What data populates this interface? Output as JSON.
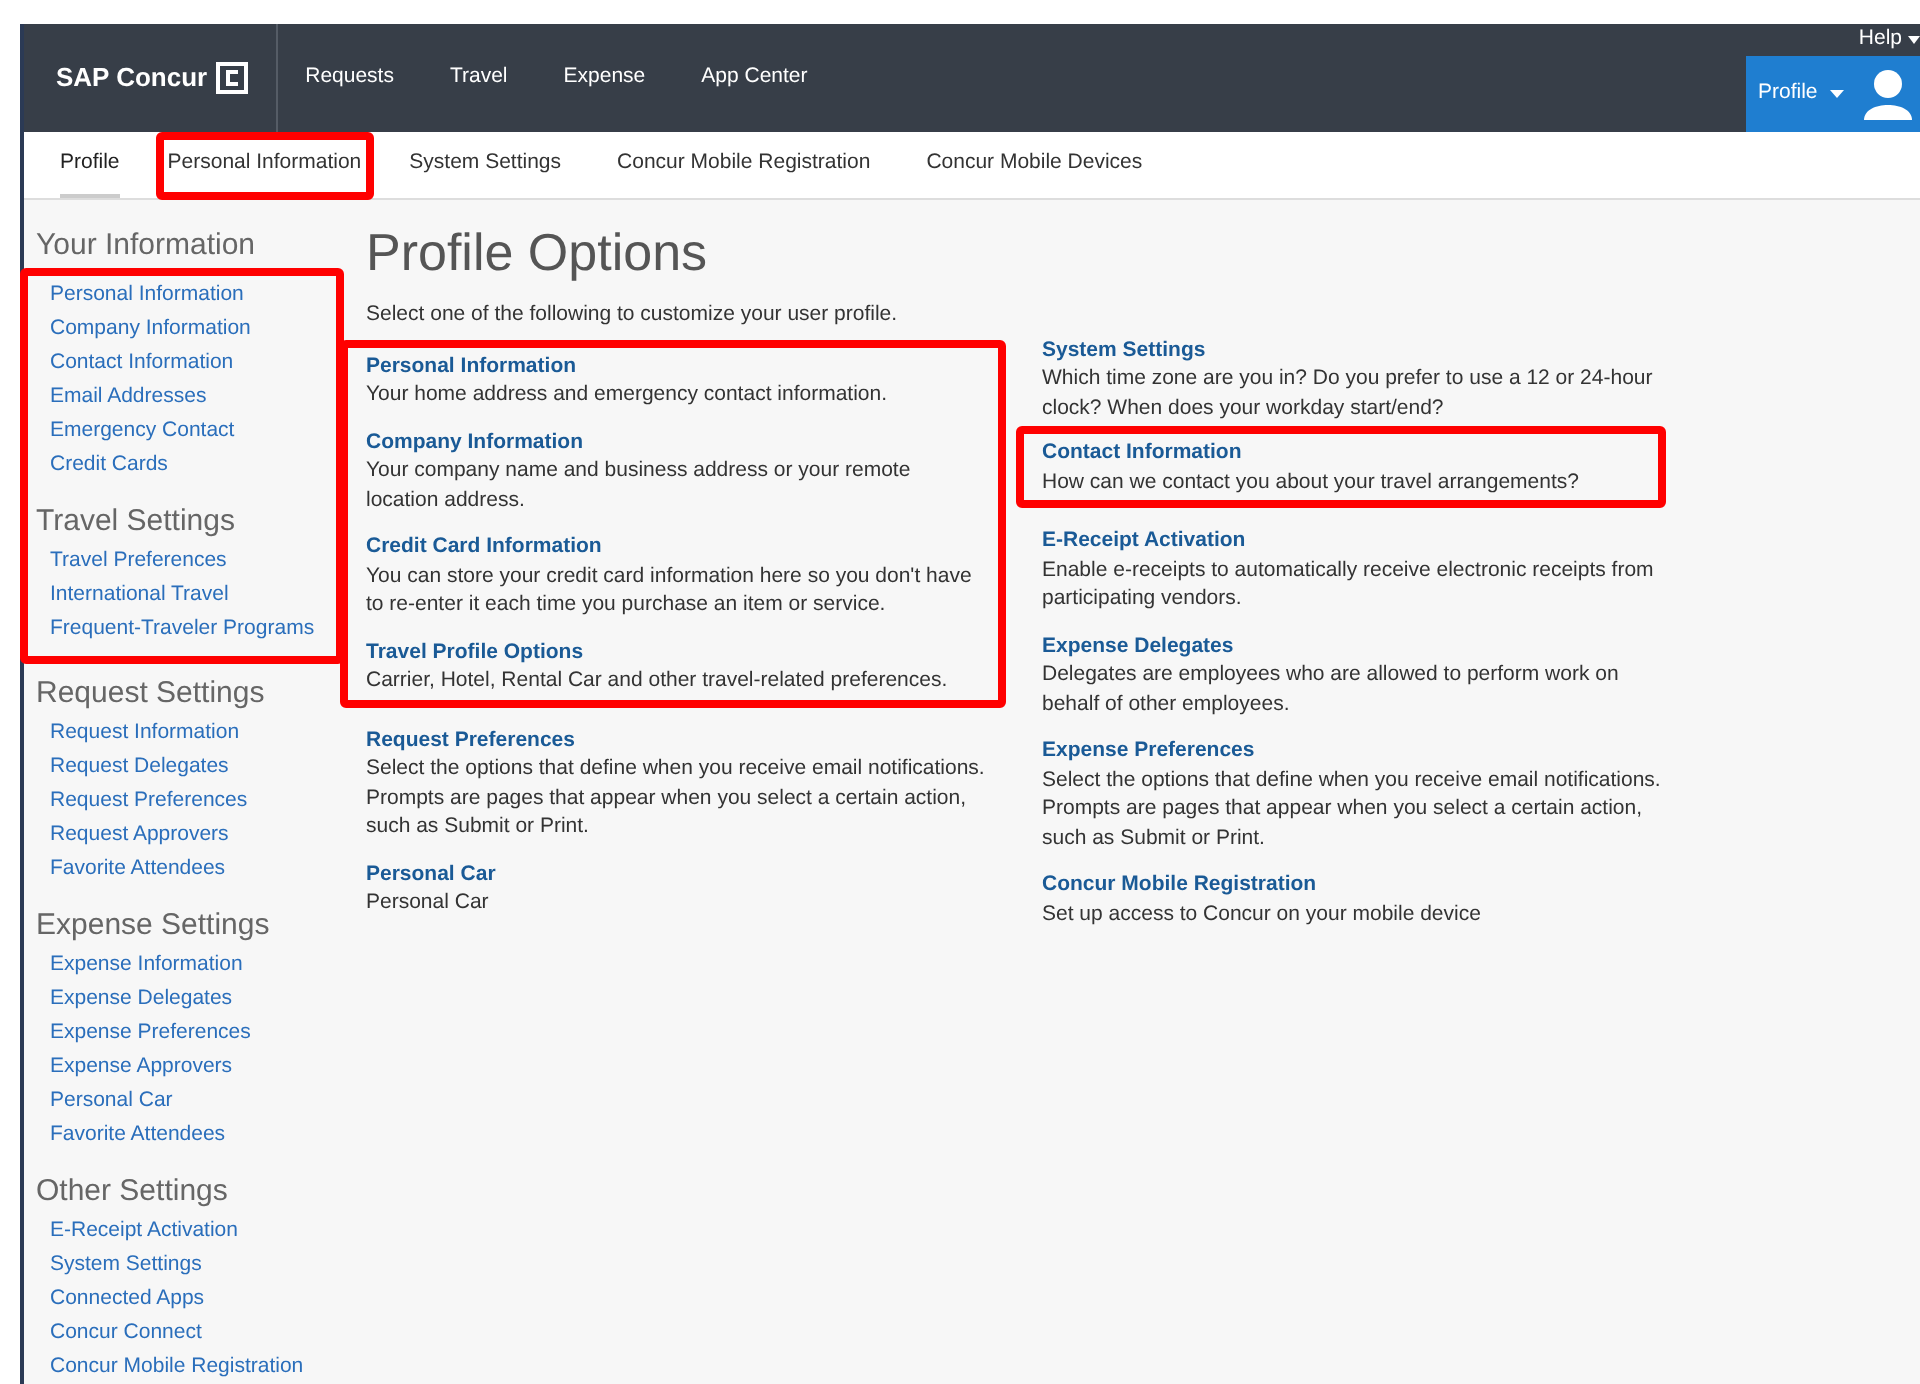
{
  "header": {
    "logo": "SAP Concur",
    "nav": [
      {
        "label": "Requests"
      },
      {
        "label": "Travel"
      },
      {
        "label": "Expense"
      },
      {
        "label": "App Center"
      }
    ],
    "help": "Help",
    "profile_button": "Profile"
  },
  "subnav": [
    {
      "label": "Profile",
      "selected": true,
      "highlighted": false
    },
    {
      "label": "Personal Information",
      "selected": false,
      "highlighted": true
    },
    {
      "label": "System Settings",
      "selected": false,
      "highlighted": false
    },
    {
      "label": "Concur Mobile Registration",
      "selected": false,
      "highlighted": false
    },
    {
      "label": "Concur Mobile Devices",
      "selected": false,
      "highlighted": false
    }
  ],
  "sidebar": [
    {
      "title": "Your Information",
      "highlighted": true,
      "items": [
        "Personal Information",
        "Company Information",
        "Contact Information",
        "Email Addresses",
        "Emergency Contact",
        "Credit Cards"
      ]
    },
    {
      "title": "Travel Settings",
      "highlighted": true,
      "items": [
        "Travel Preferences",
        "International Travel",
        "Frequent-Traveler Programs"
      ]
    },
    {
      "title": "Request Settings",
      "highlighted": false,
      "items": [
        "Request Information",
        "Request Delegates",
        "Request Preferences",
        "Request Approvers",
        "Favorite Attendees"
      ]
    },
    {
      "title": "Expense Settings",
      "highlighted": false,
      "items": [
        "Expense Information",
        "Expense Delegates",
        "Expense Preferences",
        "Expense Approvers",
        "Personal Car",
        "Favorite Attendees"
      ]
    },
    {
      "title": "Other Settings",
      "highlighted": false,
      "items": [
        "E-Receipt Activation",
        "System Settings",
        "Connected Apps",
        "Concur Connect",
        "Concur Mobile Registration"
      ]
    }
  ],
  "main": {
    "title": "Profile Options",
    "intro": "Select one of the following to customize your user profile.",
    "left_options": [
      {
        "title": "Personal Information",
        "highlighted": true,
        "description": "Your home address and emergency contact information."
      },
      {
        "title": "Company Information",
        "highlighted": true,
        "description": "Your company name and business address or your remote location address."
      },
      {
        "title": "Credit Card Information",
        "highlighted": true,
        "description": "You can store your credit card information here so you don't have to re-enter it each time you purchase an item or service."
      },
      {
        "title": "Travel Profile Options",
        "highlighted": true,
        "description": "Carrier, Hotel, Rental Car and other travel-related preferences."
      },
      {
        "title": "Request Preferences",
        "highlighted": false,
        "description": "Select the options that define when you receive email notifications. Prompts are pages that appear when you select a certain action, such as Submit or Print."
      },
      {
        "title": "Personal Car",
        "highlighted": false,
        "description": "Personal Car"
      }
    ],
    "right_options": [
      {
        "title": "System Settings",
        "highlighted": false,
        "description": "Which time zone are you in? Do you prefer to use a 12 or 24-hour clock? When does your workday start/end?"
      },
      {
        "title": "Contact Information",
        "highlighted": true,
        "description": "How can we contact you about your travel arrangements?"
      },
      {
        "title": "E-Receipt Activation",
        "highlighted": false,
        "description": "Enable e-receipts to automatically receive electronic receipts from participating vendors."
      },
      {
        "title": "Expense Delegates",
        "highlighted": false,
        "description": "Delegates are employees who are allowed to perform work on behalf of other employees."
      },
      {
        "title": "Expense Preferences",
        "highlighted": false,
        "description": "Select the options that define when you receive email notifications. Prompts are pages that appear when you select a certain action, such as Submit or Print."
      },
      {
        "title": "Concur Mobile Registration",
        "highlighted": false,
        "description": "Set up access to Concur on your mobile device"
      }
    ]
  }
}
